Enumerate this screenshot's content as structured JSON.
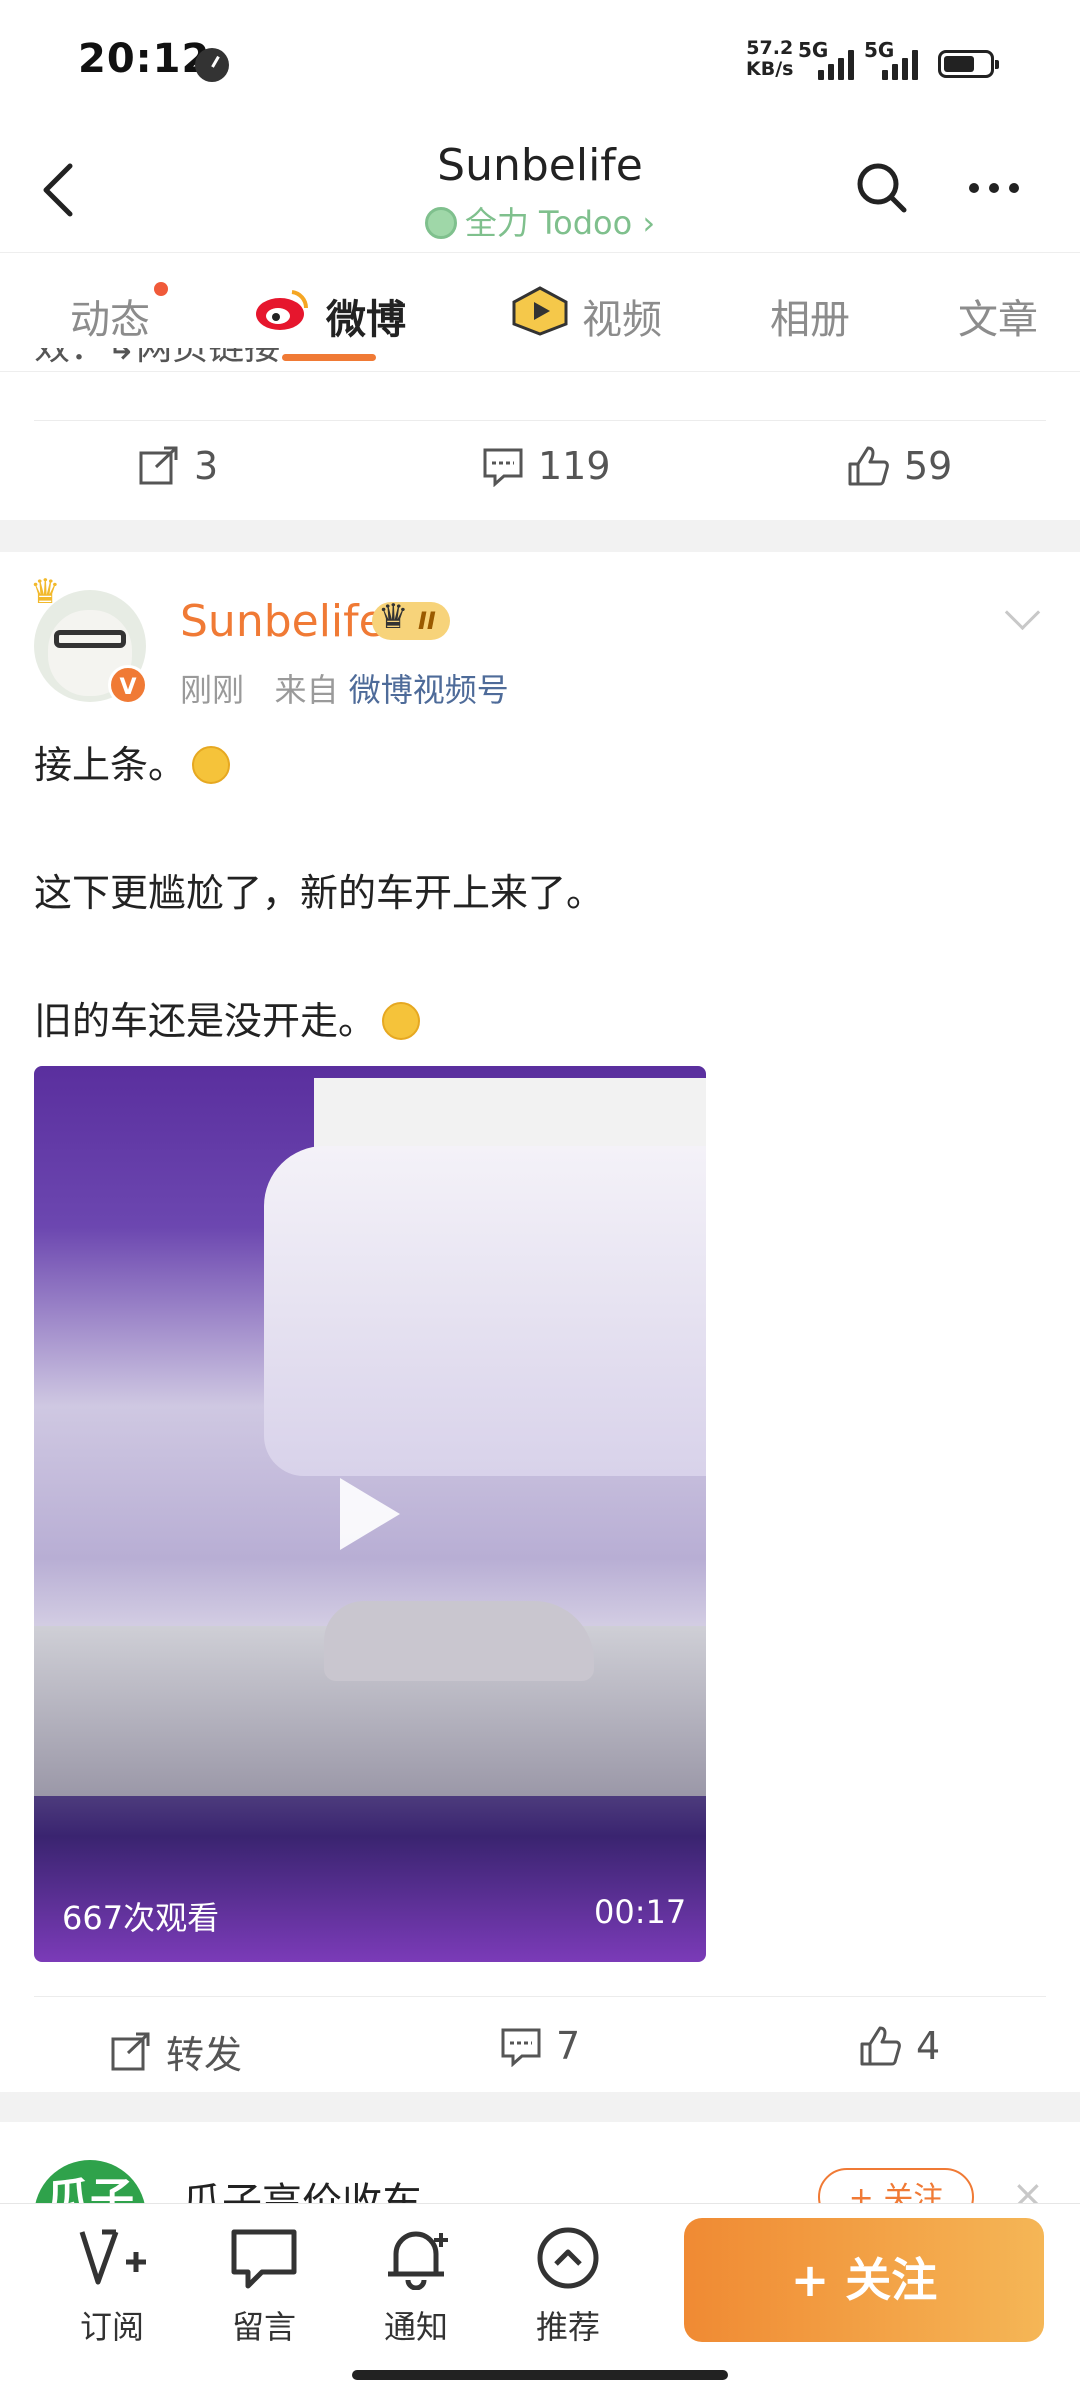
{
  "status_bar": {
    "time": "20:12",
    "net_speed_value": "57.2",
    "net_speed_unit": "KB/s",
    "signal1": "5G",
    "signal2": "5G"
  },
  "header": {
    "title": "Sunbelife",
    "subtitle": "全力 Todoo",
    "subtitle_chevron": "›"
  },
  "tabs": [
    {
      "label": "动态",
      "active": false
    },
    {
      "label": "微博",
      "active": true
    },
    {
      "label": "视频",
      "active": false
    },
    {
      "label": "相册",
      "active": false
    },
    {
      "label": "文章",
      "active": false
    }
  ],
  "prev_post": {
    "truncated_text": "效：↳网页链接",
    "reposts": "3",
    "comments": "119",
    "likes": "59"
  },
  "post": {
    "author": "Sunbelife",
    "vip_level": "II",
    "time": "刚刚",
    "source_prefix": "来自",
    "source": "微博视频号",
    "lines": [
      "接上条。",
      "这下更尴尬了，新的车开上来了。",
      "旧的车还是没开走。"
    ],
    "video": {
      "views": "667次观看",
      "duration": "00:17"
    },
    "actions": {
      "repost": "转发",
      "comments": "7",
      "likes": "4"
    }
  },
  "next_post": {
    "avatar_text": "瓜子",
    "author": "瓜子高价收车",
    "follow": "+ 关注",
    "close": "×"
  },
  "bottom_bar": {
    "items": [
      {
        "label": "订阅",
        "icon": "subscribe-icon"
      },
      {
        "label": "留言",
        "icon": "message-icon"
      },
      {
        "label": "通知",
        "icon": "bell-icon"
      },
      {
        "label": "推荐",
        "icon": "recommend-icon"
      }
    ],
    "follow_label": "+ 关注"
  },
  "colors": {
    "accent": "#f07a35",
    "link": "#4e6b99",
    "verified_green": "#7fc08d"
  }
}
